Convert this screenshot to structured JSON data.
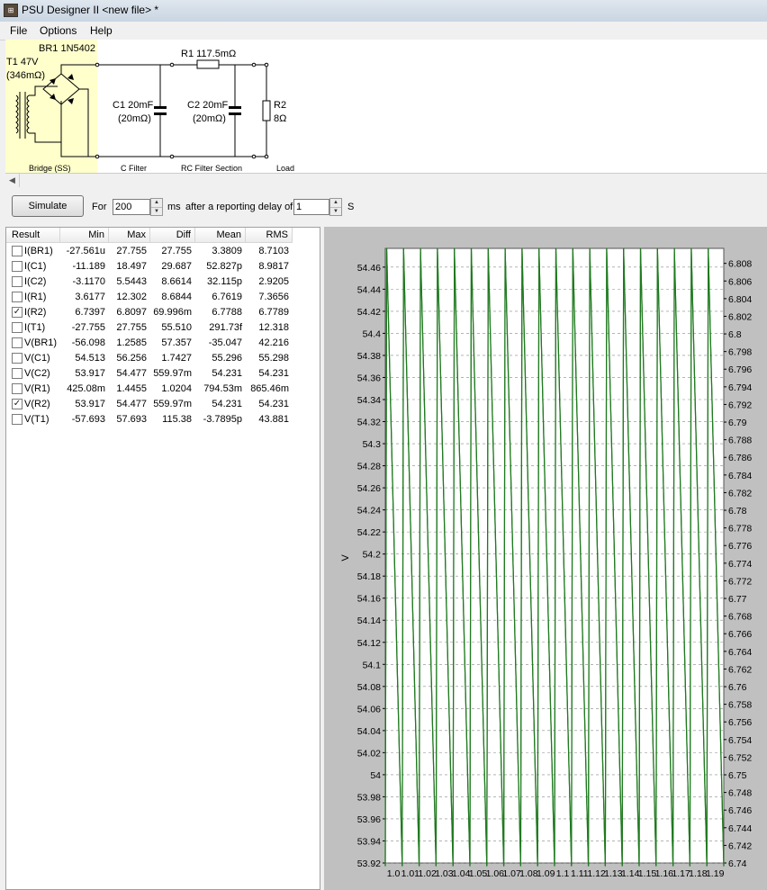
{
  "window": {
    "title": "PSU Designer II  <new file>  *",
    "icon": "app-icon"
  },
  "menu": [
    "File",
    "Options",
    "Help"
  ],
  "schematic": {
    "bridge_label": "BR1 1N5402",
    "transformer_label": "T1 47V",
    "transformer_res": "(346mΩ)",
    "c1_label": "C1 20mF",
    "c1_res": "(20mΩ)",
    "r1_label": "R1 117.5mΩ",
    "c2_label": "C2 20mF",
    "c2_res": "(20mΩ)",
    "r2_label": "R2",
    "r2_value": "8Ω",
    "section_bridge": "Bridge (SS)",
    "section_c_filter": "C Filter",
    "section_rc_filter": "RC Filter Section",
    "section_load": "Load"
  },
  "toolbar": {
    "simulate_label": "Simulate",
    "for_label": "For",
    "duration_value": "200",
    "ms_label": "ms",
    "delay_label": "after a reporting delay of",
    "delay_value": "1",
    "s_label": "S"
  },
  "results": {
    "columns": [
      "Result",
      "Min",
      "Max",
      "Diff",
      "Mean",
      "RMS"
    ],
    "rows": [
      {
        "name": "I(BR1)",
        "checked": false,
        "min": "-27.561u",
        "max": "27.755",
        "diff": "27.755",
        "mean": "3.3809",
        "rms": "8.7103"
      },
      {
        "name": "I(C1)",
        "checked": false,
        "min": "-11.189",
        "max": "18.497",
        "diff": "29.687",
        "mean": "52.827p",
        "rms": "8.9817"
      },
      {
        "name": "I(C2)",
        "checked": false,
        "min": "-3.1170",
        "max": "5.5443",
        "diff": "8.6614",
        "mean": "32.115p",
        "rms": "2.9205"
      },
      {
        "name": "I(R1)",
        "checked": false,
        "min": "3.6177",
        "max": "12.302",
        "diff": "8.6844",
        "mean": "6.7619",
        "rms": "7.3656"
      },
      {
        "name": "I(R2)",
        "checked": true,
        "min": "6.7397",
        "max": "6.8097",
        "diff": "69.996m",
        "mean": "6.7788",
        "rms": "6.7789"
      },
      {
        "name": "I(T1)",
        "checked": false,
        "min": "-27.755",
        "max": "27.755",
        "diff": "55.510",
        "mean": "291.73f",
        "rms": "12.318"
      },
      {
        "name": "V(BR1)",
        "checked": false,
        "min": "-56.098",
        "max": "1.2585",
        "diff": "57.357",
        "mean": "-35.047",
        "rms": "42.216"
      },
      {
        "name": "V(C1)",
        "checked": false,
        "min": "54.513",
        "max": "56.256",
        "diff": "1.7427",
        "mean": "55.296",
        "rms": "55.298"
      },
      {
        "name": "V(C2)",
        "checked": false,
        "min": "53.917",
        "max": "54.477",
        "diff": "559.97m",
        "mean": "54.231",
        "rms": "54.231"
      },
      {
        "name": "V(R1)",
        "checked": false,
        "min": "425.08m",
        "max": "1.4455",
        "diff": "1.0204",
        "mean": "794.53m",
        "rms": "865.46m"
      },
      {
        "name": "V(R2)",
        "checked": true,
        "min": "53.917",
        "max": "54.477",
        "diff": "559.97m",
        "mean": "54.231",
        "rms": "54.231"
      },
      {
        "name": "V(T1)",
        "checked": false,
        "min": "-57.693",
        "max": "57.693",
        "diff": "115.38",
        "mean": "-3.7895p",
        "rms": "43.881"
      }
    ]
  },
  "chart_data": {
    "type": "line",
    "y_left_label": "V",
    "y_left_ticks": [
      "54.46",
      "54.44",
      "54.42",
      "54.4",
      "54.38",
      "54.36",
      "54.34",
      "54.32",
      "54.3",
      "54.28",
      "54.26",
      "54.24",
      "54.22",
      "54.2",
      "54.18",
      "54.16",
      "54.14",
      "54.12",
      "54.1",
      "54.08",
      "54.06",
      "54.04",
      "54.02",
      "54",
      "53.98",
      "53.96",
      "53.94",
      "53.92"
    ],
    "y_left_range": [
      53.92,
      54.477
    ],
    "y_right_ticks": [
      "6.808",
      "6.806",
      "6.804",
      "6.802",
      "6.8",
      "6.798",
      "6.796",
      "6.794",
      "6.792",
      "6.79",
      "6.788",
      "6.786",
      "6.784",
      "6.782",
      "6.78",
      "6.778",
      "6.776",
      "6.774",
      "6.772",
      "6.77",
      "6.768",
      "6.766",
      "6.764",
      "6.762",
      "6.76",
      "6.758",
      "6.756",
      "6.754",
      "6.752",
      "6.75",
      "6.748",
      "6.746",
      "6.744",
      "6.742",
      "6.74"
    ],
    "y_right_range": [
      6.74,
      6.8097
    ],
    "x_ticks": [
      "1.0",
      "1.01",
      "1.02",
      "1.03",
      "1.04",
      "1.05",
      "1.06",
      "1.07",
      "1.08",
      "1.09",
      "1.1",
      "1.11",
      "1.12",
      "1.13",
      "1.14",
      "1.15",
      "1.16",
      "1.17",
      "1.18",
      "1.19"
    ],
    "x_range": [
      1.0,
      1.2
    ],
    "ripple_cycles": 20,
    "series": [
      {
        "name": "I(R2)",
        "color": "#1f7a1f",
        "min": 6.7397,
        "max": 6.8097
      },
      {
        "name": "V(R2)",
        "color": "#1f7a1f",
        "min": 53.917,
        "max": 54.477
      }
    ],
    "grid": true
  },
  "colors": {
    "bridge_highlight": "#ffffcc",
    "chart_bg": "#c0c0c0",
    "trace": "#1f7a1f"
  }
}
